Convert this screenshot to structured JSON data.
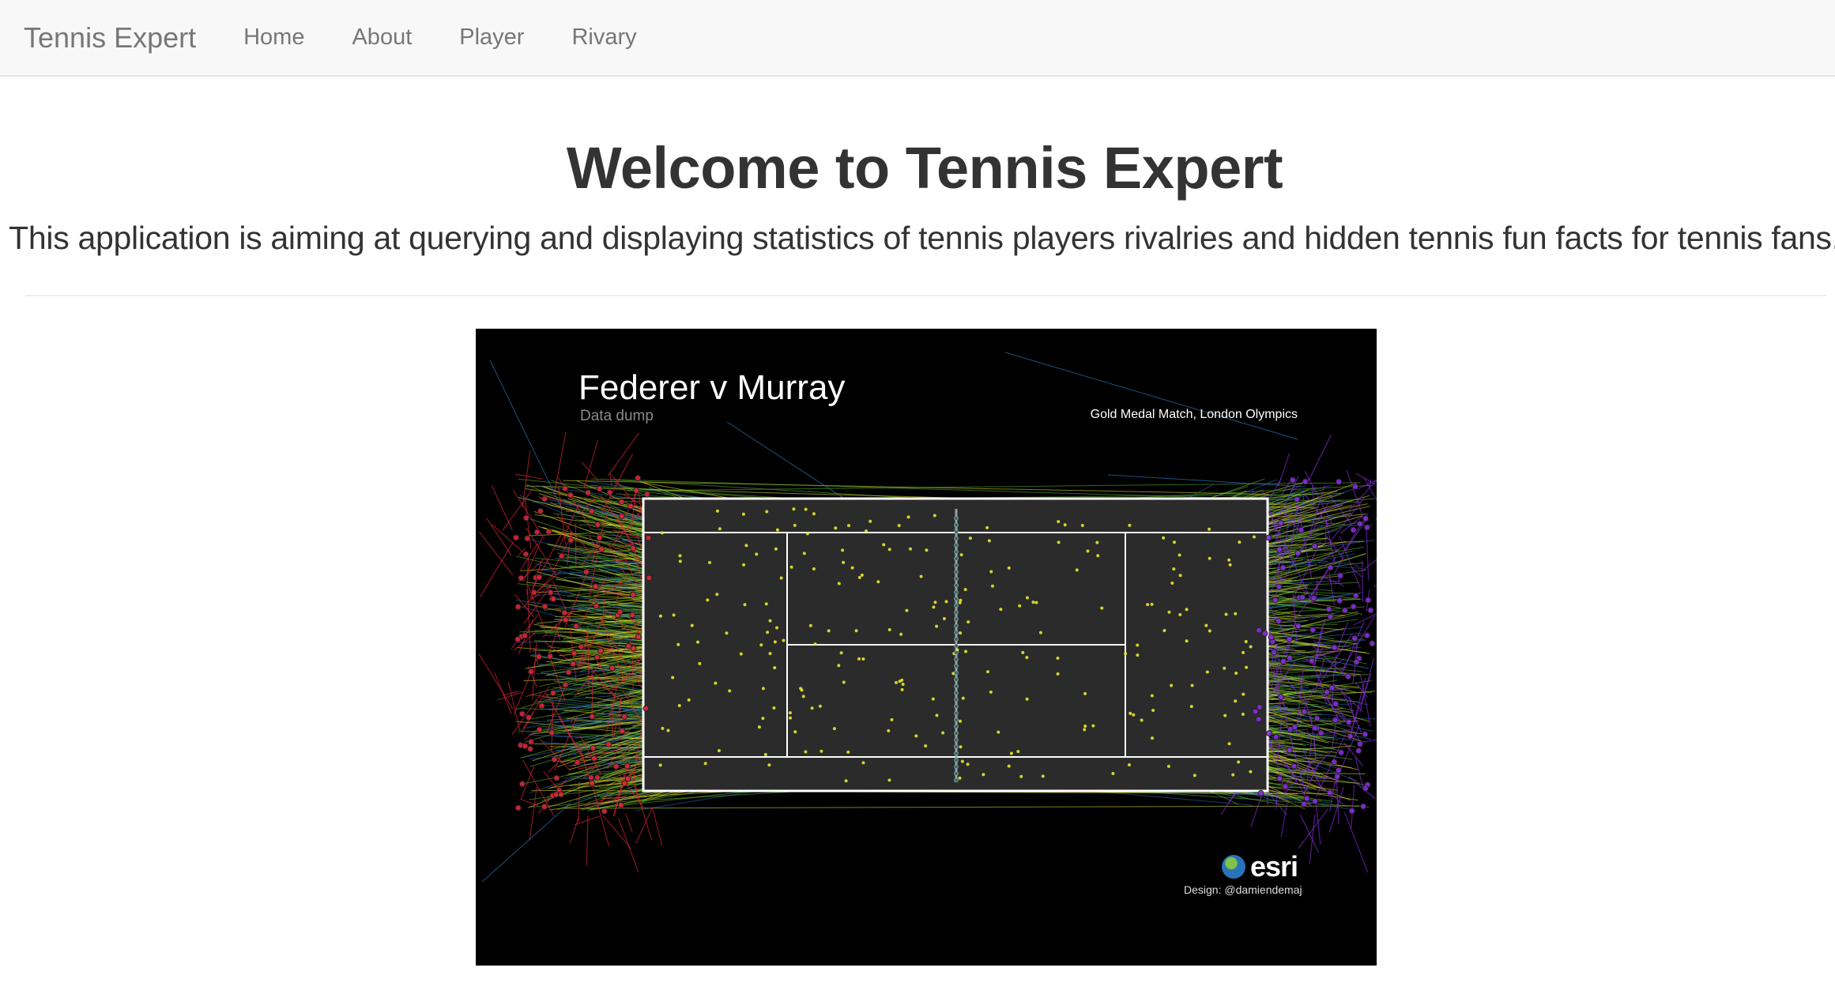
{
  "navbar": {
    "brand": "Tennis Expert",
    "items": [
      {
        "label": "Home"
      },
      {
        "label": "About"
      },
      {
        "label": "Player"
      },
      {
        "label": "Rivary"
      }
    ]
  },
  "main": {
    "title": "Welcome to Tennis Expert",
    "lead": "This application is aiming at querying and displaying statistics of tennis players rivalries and hidden tennis fun facts for tennis fans."
  },
  "figure": {
    "title": "Federer v Murray",
    "subtitle": "Data dump",
    "caption": "Gold Medal Match, London Olympics",
    "logo_text": "esri",
    "credit": "Design: @damiendemaj",
    "colors": {
      "background": "#000000",
      "court_lines": "#ffffff",
      "shots_left": "#e0243a",
      "shots_right": "#8a2be2",
      "shots_mid": "#2a73b8",
      "shots_green": "#5cb82e",
      "shots_yellow": "#e8e82a"
    }
  }
}
